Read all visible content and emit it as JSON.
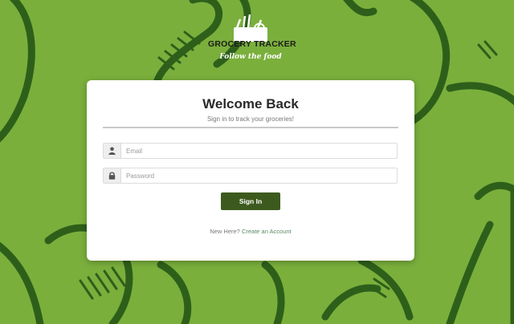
{
  "brand": {
    "name": "GROCERY TRACKER",
    "tagline": "Follow the food"
  },
  "login": {
    "title": "Welcome Back",
    "subtitle": "Sign in to track your groceries!",
    "email_placeholder": "Email",
    "email_value": "",
    "password_placeholder": "Password",
    "password_value": "",
    "submit_label": "Sign In",
    "signup_prompt": "New Here?",
    "signup_link": "Create an Account"
  },
  "icons": {
    "email_field": "user-icon",
    "password_field": "lock-icon",
    "logo": "shopping-bag-icon"
  },
  "colors": {
    "background": "#7aaf3c",
    "illustration": "#2e5f1a",
    "card": "#ffffff",
    "button": "#3d5a1e",
    "link": "#5a8a66"
  }
}
